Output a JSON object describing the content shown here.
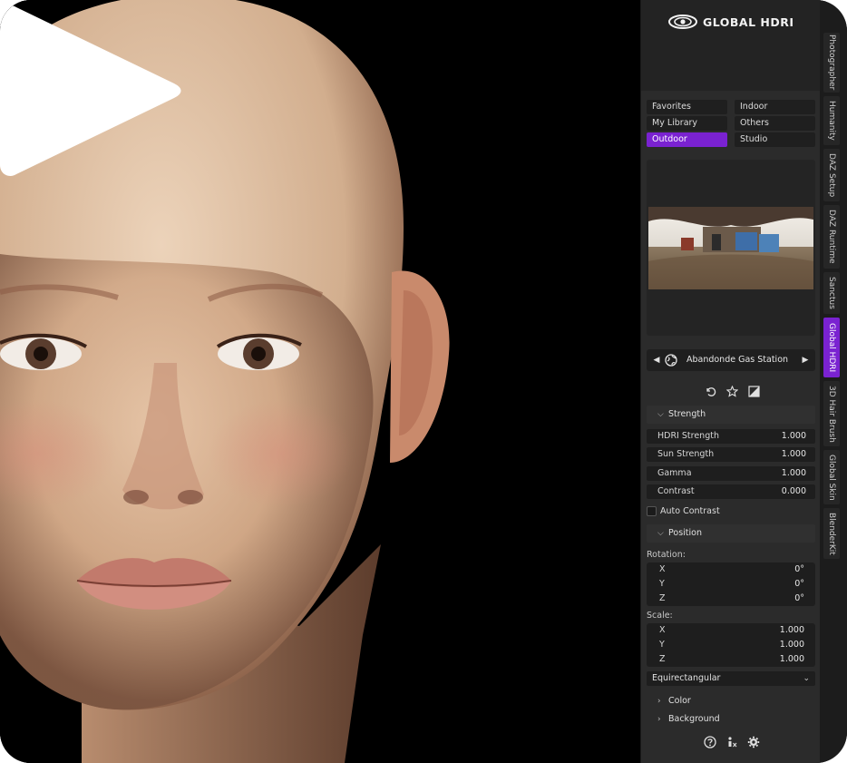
{
  "brand": {
    "logo_text": "GLOBAL HDRI",
    "accent": "#7a22d1"
  },
  "categories": [
    {
      "label": "Favorites",
      "active": false
    },
    {
      "label": "Indoor",
      "active": false
    },
    {
      "label": "My Library",
      "active": false
    },
    {
      "label": "Others",
      "active": false
    },
    {
      "label": "Outdoor",
      "active": true
    },
    {
      "label": "Studio",
      "active": false
    }
  ],
  "hdri": {
    "name": "Abandonde Gas Station",
    "prev_icon": "triangle-left-icon",
    "next_icon": "triangle-right-icon"
  },
  "actions": [
    {
      "icon": "reset-icon"
    },
    {
      "icon": "star-icon"
    },
    {
      "icon": "contrast-icon"
    }
  ],
  "strength": {
    "header": "Strength",
    "fields": [
      {
        "label": "HDRI Strength",
        "value": "1.000"
      },
      {
        "label": "Sun Strength",
        "value": "1.000"
      },
      {
        "label": "Gamma",
        "value": "1.000"
      },
      {
        "label": "Contrast",
        "value": "0.000"
      }
    ],
    "auto_contrast": {
      "label": "Auto Contrast",
      "checked": false
    }
  },
  "position": {
    "header": "Position",
    "rotation": {
      "label": "Rotation:",
      "rows": [
        {
          "axis": "X",
          "value": "0°"
        },
        {
          "axis": "Y",
          "value": "0°"
        },
        {
          "axis": "Z",
          "value": "0°"
        }
      ]
    },
    "scale": {
      "label": "Scale:",
      "rows": [
        {
          "axis": "X",
          "value": "1.000"
        },
        {
          "axis": "Y",
          "value": "1.000"
        },
        {
          "axis": "Z",
          "value": "1.000"
        }
      ]
    },
    "projection": "Equirectangular"
  },
  "collapsed_sections": [
    {
      "label": "Color"
    },
    {
      "label": "Background"
    }
  ],
  "footer_icons": [
    "help-icon",
    "info-icon",
    "settings-icon"
  ],
  "side_tabs": [
    {
      "label": "Photographer",
      "active": false
    },
    {
      "label": "Humanity",
      "active": false
    },
    {
      "label": "DAZ Setup",
      "active": false
    },
    {
      "label": "DAZ Runtime",
      "active": false
    },
    {
      "label": "Sanctus",
      "active": false
    },
    {
      "label": "Global HDRI",
      "active": true
    },
    {
      "label": "3D Hair Brush",
      "active": false
    },
    {
      "label": "Global Skin",
      "active": false
    },
    {
      "label": "BlenderKit",
      "active": false
    }
  ],
  "overlay": {
    "icon": "play-icon"
  }
}
